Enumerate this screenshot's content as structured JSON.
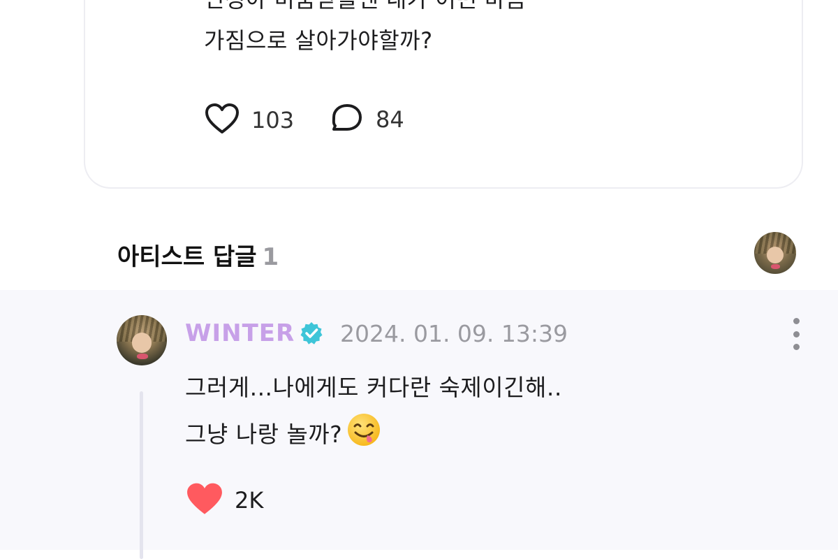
{
  "post": {
    "text_line1": "민정아 미움받을땐 내가 어떤 마음",
    "text_line2": "가짐으로 살아가야할까?",
    "like_count": "103",
    "comment_count": "84"
  },
  "artist_reply_section": {
    "title": "아티스트 답글",
    "count": "1"
  },
  "reply": {
    "author": "WINTER",
    "timestamp": "2024. 01. 09. 13:39",
    "text_line1": "그러게...나에게도 커다란 숙제이긴해..",
    "text_line2": "그냥 나랑 놀까?",
    "emoji": "face-savoring-food",
    "like_count": "2K",
    "liked": true
  },
  "icons": {
    "like": "heart-outline-icon",
    "comment": "speech-bubble-icon",
    "verified": "verified-badge-icon",
    "more": "more-vertical-icon",
    "reply_like": "heart-filled-icon"
  },
  "colors": {
    "author_name": "#c7a0e8",
    "verified_badge": "#3ec5d8",
    "heart_filled": "#ff5a5f",
    "reply_background": "#f8f8fc"
  }
}
